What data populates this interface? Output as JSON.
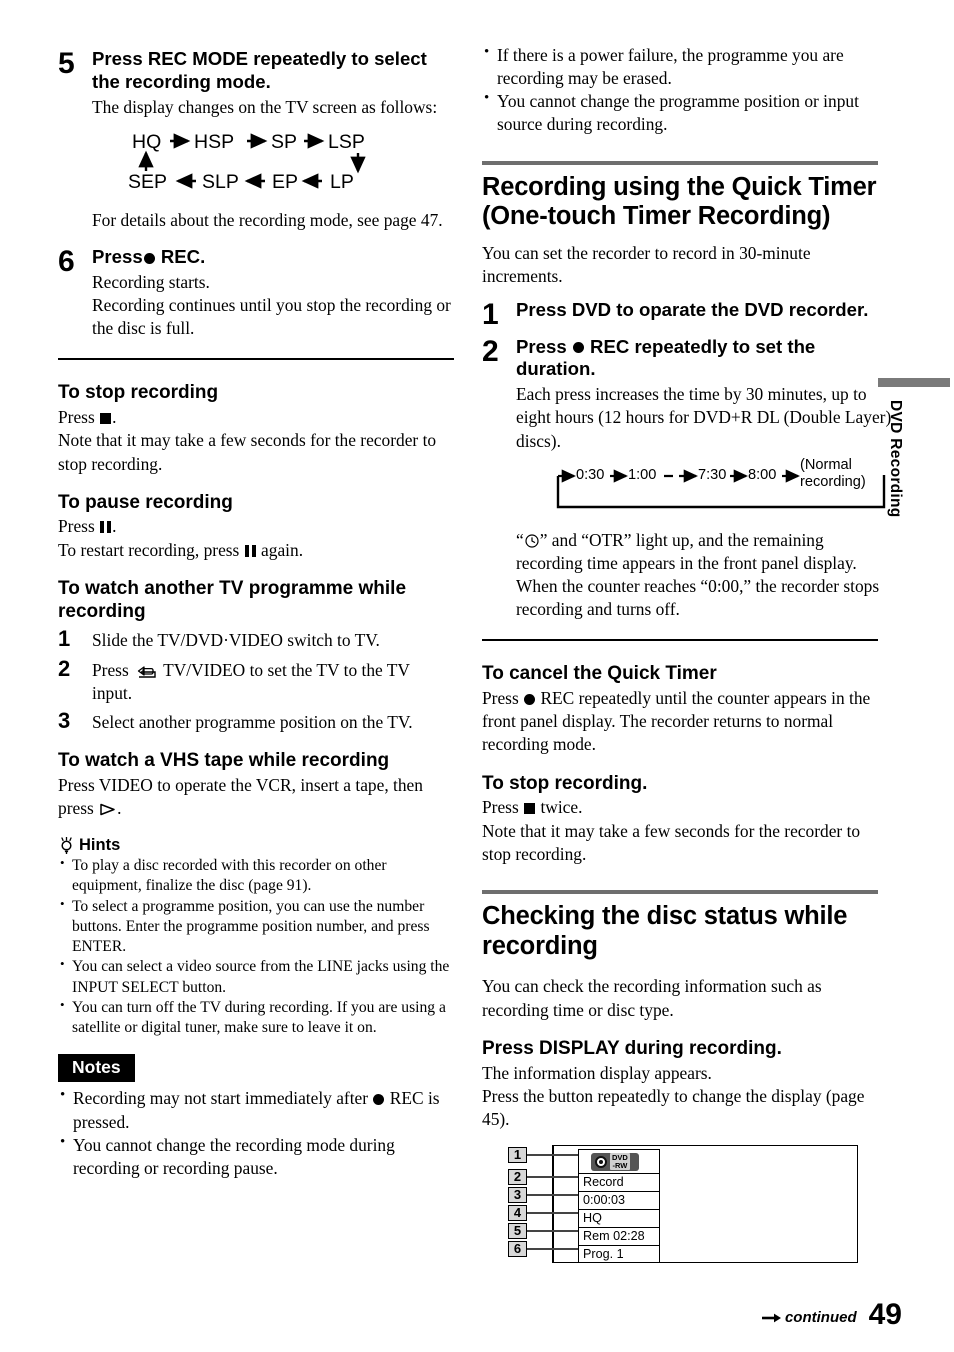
{
  "page": {
    "number": "49",
    "continued_label": "continued",
    "side_tab": "DVD Recording"
  },
  "left_column": {
    "step5": {
      "num": "5",
      "title": "Press REC MODE repeatedly to select the recording mode.",
      "text": "The display changes on the TV screen as follows:",
      "flow": {
        "top_row": [
          "HQ",
          "HSP",
          "SP",
          "LSP"
        ],
        "bottom_row": [
          "SEP",
          "SLP",
          "EP",
          "LP"
        ]
      },
      "after": "For details about the recording mode, see page 47."
    },
    "step6": {
      "num": "6",
      "title_prefix": "Press",
      "title_suffix": "REC.",
      "line1": "Recording starts.",
      "line2": "Recording continues until you stop the recording or the disc is full."
    },
    "stop_recording": {
      "heading": "To stop recording",
      "press_prefix": "Press",
      "press_suffix": ".",
      "note": "Note that it may take a few seconds for the recorder to stop recording."
    },
    "pause_recording": {
      "heading": "To pause recording",
      "press_prefix": "Press",
      "press_suffix": ".",
      "restart_prefix": "To restart recording, press",
      "restart_suffix": "again."
    },
    "watch_tv": {
      "heading": "To watch another TV programme while recording",
      "steps": [
        {
          "num": "1",
          "text": "Slide the TV/DVD·VIDEO switch to TV."
        },
        {
          "num": "2",
          "prefix": "Press",
          "suffix": "TV/VIDEO to set the TV to the TV input."
        },
        {
          "num": "3",
          "text": "Select another programme position on the TV."
        }
      ]
    },
    "watch_vhs": {
      "heading": "To watch a VHS tape while recording",
      "text_prefix": "Press VIDEO to operate the VCR, insert a tape, then press",
      "text_suffix": "."
    },
    "hints": {
      "heading": "Hints",
      "items": [
        "To play a disc recorded with this recorder on other equipment, finalize the disc (page 91).",
        "To select a programme position, you can use the number buttons. Enter the programme position number, and press ENTER.",
        "You can select a video source from the LINE jacks using the INPUT SELECT button.",
        "You can turn off the TV during recording. If you are using a satellite or digital tuner, make sure to leave it on."
      ]
    },
    "notes": {
      "heading": "Notes",
      "item1_prefix": "Recording may not start immediately after",
      "item1_suffix": "REC is pressed.",
      "item2": "You cannot change the recording mode during recording or recording pause."
    }
  },
  "right_column": {
    "top_notes": [
      "If there is a power failure, the programme you are recording may be erased.",
      "You cannot change the programme position or input source during recording."
    ],
    "quick_timer": {
      "heading": "Recording using the Quick Timer (One-touch Timer Recording)",
      "intro": "You can set the recorder to record in 30-minute increments.",
      "step1": {
        "num": "1",
        "title": "Press DVD to oparate the DVD recorder."
      },
      "step2": {
        "num": "2",
        "title_prefix": "Press",
        "title_suffix": "REC repeatedly to set the duration.",
        "text": "Each press increases the time by 30 minutes, up to eight hours (12 hours for DVD+R DL (Double Layer) discs)."
      },
      "diagram": {
        "values": [
          "0:30",
          "1:00",
          "7:30",
          "8:00"
        ],
        "normal_line1": "(Normal",
        "normal_line2": "recording)"
      },
      "after_line1_a": "“",
      "after_line1_b": "” and “OTR” light up, and the remaining recording time appears in the front panel display.",
      "after_line2": "When the counter reaches “0:00,” the recorder stops recording and turns off."
    },
    "cancel_quick_timer": {
      "heading": "To cancel the Quick Timer",
      "text_prefix": "Press",
      "text_suffix": "REC repeatedly until the counter appears in the front panel display. The recorder returns to normal recording mode."
    },
    "stop_recording": {
      "heading": "To stop recording.",
      "press_prefix": "Press",
      "press_suffix": "twice.",
      "note": "Note that it may take a few seconds for the recorder to stop recording."
    },
    "checking_disc": {
      "heading": "Checking the disc status while recording",
      "intro": "You can check the recording information such as recording time or disc type.",
      "subhead": "Press DISPLAY during recording.",
      "line1": "The information display appears.",
      "line2": "Press the button repeatedly to change the display (page 45)."
    },
    "osd": {
      "callouts": [
        "1",
        "2",
        "3",
        "4",
        "5",
        "6"
      ],
      "disc_badge": {
        "line1": "DVD",
        "line2": "-RW"
      },
      "rows": [
        "Record",
        "0:00:03",
        "HQ",
        "Rem 02:28",
        "Prog. 1"
      ]
    }
  }
}
